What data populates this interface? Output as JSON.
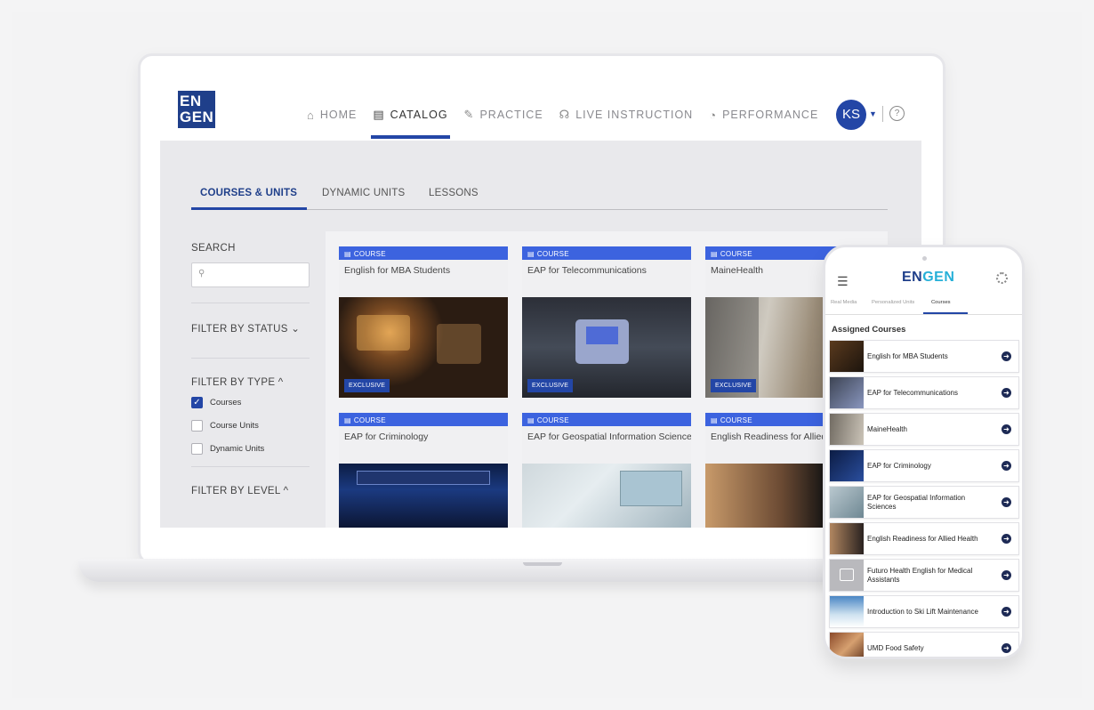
{
  "laptop": {
    "logo": {
      "line1": "EN",
      "line2": "GEN"
    },
    "nav": [
      {
        "label": "HOME",
        "icon": "home-icon",
        "glyph": "⌂",
        "active": false
      },
      {
        "label": "CATALOG",
        "icon": "catalog-icon",
        "glyph": "▤",
        "active": true
      },
      {
        "label": "PRACTICE",
        "icon": "practice-icon",
        "glyph": "✎",
        "active": false
      },
      {
        "label": "LIVE INSTRUCTION",
        "icon": "headset-icon",
        "glyph": "☊",
        "active": false
      },
      {
        "label": "PERFORMANCE",
        "icon": "performance-icon",
        "glyph": "◔",
        "active": false
      }
    ],
    "avatar": "KS",
    "help_glyph": "?",
    "tabs": [
      "COURSES & UNITS",
      "DYNAMIC UNITS",
      "LESSONS"
    ],
    "filters": {
      "search_label": "SEARCH",
      "search_glyph": "⚲",
      "status_label": "FILTER BY STATUS ⌄",
      "type_label": "FILTER BY TYPE ^",
      "type_options": [
        {
          "label": "Courses",
          "checked": true
        },
        {
          "label": "Course Units",
          "checked": false
        },
        {
          "label": "Dynamic Units",
          "checked": false
        }
      ],
      "level_label": "FILTER BY LEVEL ^"
    },
    "cards": [
      {
        "type": "COURSE",
        "title": "English for MBA Students",
        "badge": "EXCLUSIVE"
      },
      {
        "type": "COURSE",
        "title": "EAP for Telecommunications",
        "badge": "EXCLUSIVE"
      },
      {
        "type": "COURSE",
        "title": "MaineHealth",
        "badge": "EXCLUSIVE"
      },
      {
        "type": "COURSE",
        "title": "EAP for Criminology",
        "badge": ""
      },
      {
        "type": "COURSE",
        "title": "EAP for Geospatial Information Sciences",
        "badge": ""
      },
      {
        "type": "COURSE",
        "title": "English Readiness for Allied Health",
        "badge": ""
      }
    ]
  },
  "phone": {
    "logo_en": "EN",
    "logo_gen": "GEN",
    "tabs": [
      "Real Media",
      "Personalized Units",
      "Courses"
    ],
    "section_title": "Assigned Courses",
    "courses": [
      "English for MBA Students",
      "EAP for Telecommunications",
      "MaineHealth",
      "EAP for Criminology",
      "EAP for Geospatial Information Sciences",
      "English Readiness for Allied Health",
      "Futuro Health English for Medical Assistants",
      "Introduction to Ski Lift Maintenance",
      "UMD Food Safety"
    ]
  },
  "colors": {
    "brand_blue": "#2346a6",
    "card_header_blue": "#3c63df",
    "logo_cyan": "#26b0d8"
  }
}
